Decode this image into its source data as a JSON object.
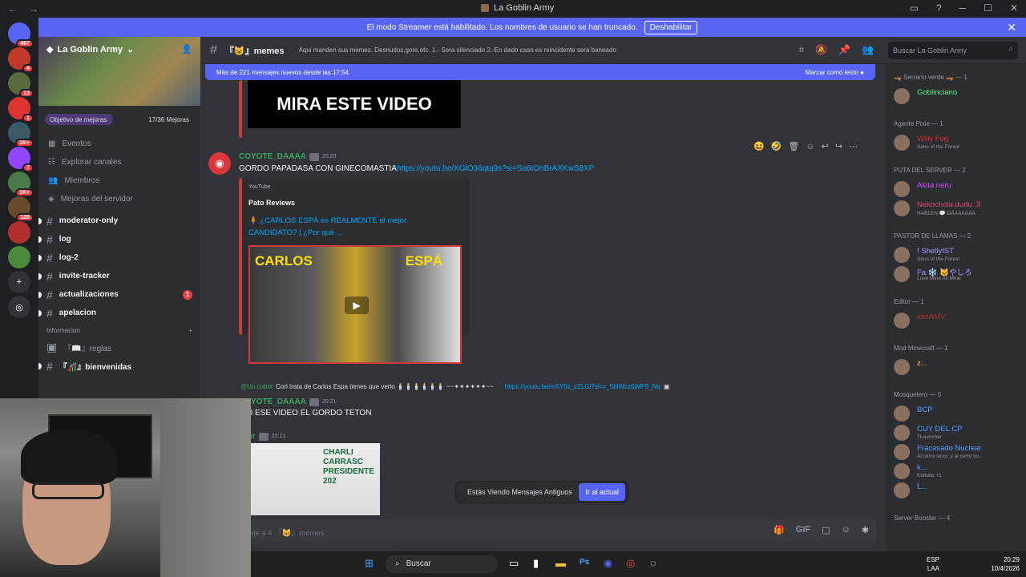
{
  "window": {
    "title": "La Goblin Army"
  },
  "streamer_banner": {
    "text": "El modo Streamer está habilitado. Los nombres de usuario se han truncado.",
    "button": "Deshabilitar"
  },
  "guilds": [
    {
      "icon": "discord-home-icon",
      "badge": "467",
      "color": "#5865f2"
    },
    {
      "icon": "server-icon",
      "badge": "4",
      "color": "#c0392b"
    },
    {
      "icon": "server-icon",
      "badge": "13",
      "color": "#5a6a3a"
    },
    {
      "icon": "server-icon",
      "badge": "1",
      "color": "#d33"
    },
    {
      "icon": "server-icon",
      "badge": "1K+",
      "color": "#3a5a6a"
    },
    {
      "icon": "twitch-icon",
      "badge": "7",
      "color": "#9146ff"
    },
    {
      "icon": "server-icon",
      "badge": "1K+",
      "color": "#4a7a4a"
    },
    {
      "icon": "server-icon",
      "badge": "129",
      "color": "#6a4a2a"
    },
    {
      "icon": "server-icon",
      "badge": "",
      "color": "#b03030"
    },
    {
      "icon": "server-icon",
      "badge": "",
      "color": "#4a8a3a"
    },
    {
      "icon": "add-server-icon",
      "badge": "",
      "color": "#313338"
    },
    {
      "icon": "discover-icon",
      "badge": "",
      "color": "#313338"
    }
  ],
  "server": {
    "name": "La Goblin Army",
    "boost_goal": "Objetivo de mejoras",
    "boost_progress": "17/36 Mejoras",
    "boost_fraction": 0.47,
    "menu": [
      "Eventos",
      "Explorar canales",
      "Miembros",
      "Mejoras del servidor"
    ],
    "channels": [
      {
        "name": "moderator-only",
        "badge": ""
      },
      {
        "name": "log",
        "badge": ""
      },
      {
        "name": "log-2",
        "badge": ""
      },
      {
        "name": "invite-tracker",
        "badge": ""
      },
      {
        "name": "actualizaciones",
        "badge": "1"
      },
      {
        "name": "apelacion",
        "badge": ""
      }
    ],
    "category": "Informacion",
    "info_channels": [
      {
        "name": "『📖』reglas"
      },
      {
        "name": "『🎢』bienvenidas"
      }
    ]
  },
  "header": {
    "channel": "『😺』memes",
    "topic": "Aqui manden sus memes. Desnudos,gore,etc. 1.- Sera silenciado 2.-En dado caso es reincidente sera baneado",
    "search_placeholder": "Buscar La Goblin Army"
  },
  "new_messages": {
    "text": "Más de 221 mensajes nuevos desde las 17:54",
    "action": "Marcar como leído"
  },
  "messages": {
    "prev_thumb_text": "MIRA ESTE VIDEO",
    "m1": {
      "user": "COYOTE_DAAAA",
      "time": "20:20",
      "text": "GORDO PAPADASA CON GINECOMASTIA",
      "link": "https://youtu.be/XGlO36qtq9s?si=So6tOnBrAXKwS8XP",
      "embed": {
        "provider": "YouTube",
        "author": "Pato Reviews",
        "title": "🧍 ¿CARLOS ESPÁ es REALMENTE el mejor CANDIDATO? | ¿Por qué ...",
        "thumb_left": "CARLOS",
        "thumb_right": "ESPÁ"
      }
    },
    "reply": {
      "mention": "@Un cubot",
      "text": "Cori trata de Carlos Espa tienes que verlo 🕯️🕯️🕯️🕯️🕯️🕯️ ~~✦✦✦✦✦✦~~",
      "link": "https://youtu.be/m5Y0z_zZLGl?si=v_5blWcz5jMF9_Nq"
    },
    "m2": {
      "user": "COYOTE_DAAAA",
      "time": "20:21",
      "text": "VIO ESE VIDEO EL GORDO TETON"
    },
    "m3": {
      "user": "cker",
      "time": "20:21",
      "image_text": "CHARLI CARRASC PRESIDENTE 202"
    }
  },
  "old_messages": {
    "text": "Estás Viendo Mensajes Antiguos",
    "button": "Ir al actual"
  },
  "composer": {
    "placeholder": "viar mensaje a # 『😺』memes"
  },
  "members": {
    "groups": [
      {
        "role": "🛶 Serrano verde 🛶 — 1",
        "members": [
          {
            "name": "Goblinciano",
            "status": "",
            "color": "#57f287"
          }
        ]
      },
      {
        "role": "Agente Pixie — 1",
        "members": [
          {
            "name": "Willy Fog",
            "status": "Sons of the Forest",
            "color": "#e03030"
          }
        ]
      },
      {
        "role": "PUTA DEL SERVER — 2",
        "members": [
          {
            "name": "Akita neru",
            "status": "",
            "color": "#d14cff"
          },
          {
            "name": "Nekochola dudu :3",
            "status": "HABLEN 💬 DAAAAAAA",
            "color": "#e0457b"
          }
        ]
      },
      {
        "role": "PASTOR DE LLAMAS — 2",
        "members": [
          {
            "name": "! ShellyIST",
            "status": "Sons of the Forest",
            "color": "#a0a0ff"
          },
          {
            "name": "Fa ❄️ 🐱やしろ",
            "status": "Love Mine All Mine",
            "color": "#a0a0ff"
          }
        ]
      },
      {
        "role": "Editor — 1",
        "members": [
          {
            "name": "idelAMV",
            "status": "",
            "color": "#a83030"
          }
        ]
      },
      {
        "role": "Mod Minecraft — 1",
        "members": [
          {
            "name": "z...",
            "status": "",
            "color": "#f0c040"
          }
        ]
      },
      {
        "role": "Mosquetero — 5",
        "members": [
          {
            "name": "BCP",
            "status": "",
            "color": "#5aa0ff"
          },
          {
            "name": "CUY DEL CP",
            "status": "TLauncher",
            "color": "#5aa0ff"
          },
          {
            "name": "Fracasado Nuclear",
            "status": "Al cerro sirvo, y al cerro vo...",
            "color": "#5aa0ff"
          },
          {
            "name": "k...",
            "status": "Koikatu +1",
            "color": "#5aa0ff"
          },
          {
            "name": "L...",
            "status": "",
            "color": "#5aa0ff"
          }
        ]
      },
      {
        "role": "Server Booster — 4",
        "members": []
      }
    ]
  },
  "taskbar": {
    "search": "Buscar",
    "lang": "ESP",
    "lang2": "LAA",
    "time": "20:29",
    "date": "10/4/2026"
  }
}
